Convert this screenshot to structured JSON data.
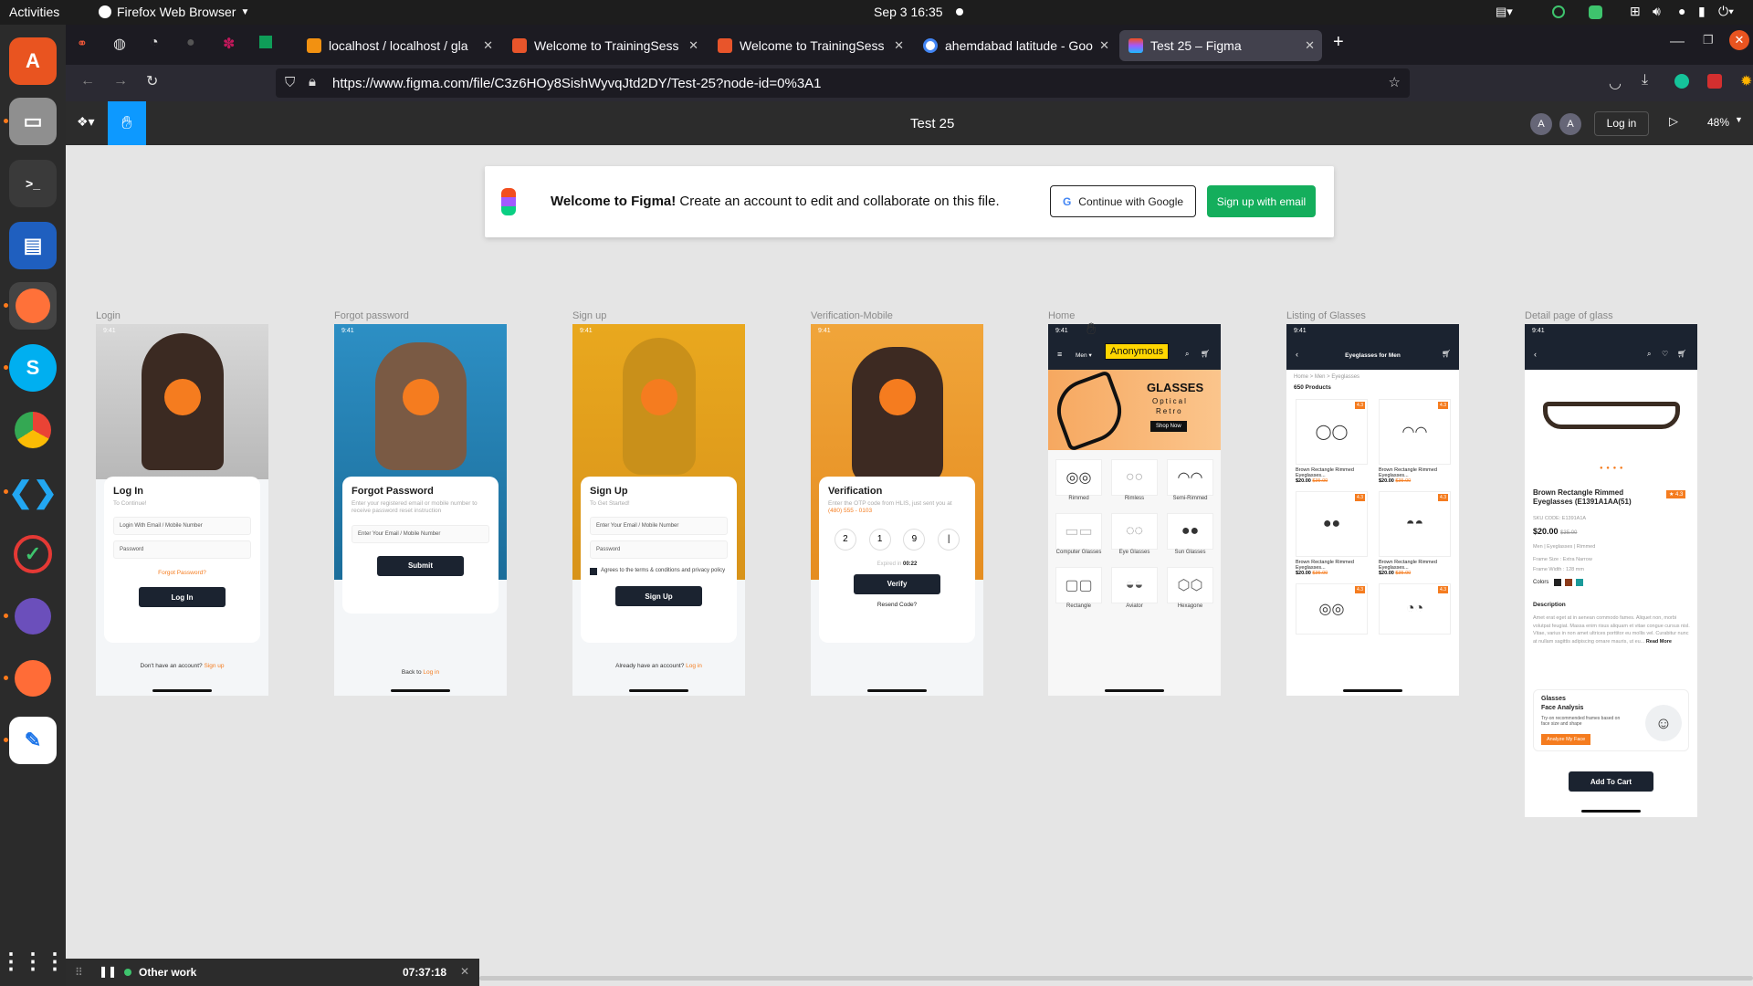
{
  "topbar": {
    "activities": "Activities",
    "app": "Firefox Web Browser",
    "datetime": "Sep 3  16:35"
  },
  "tabs": [
    {
      "label": "localhost / localhost / gla",
      "color": "#f29111"
    },
    {
      "label": "Welcome to TrainingSess",
      "color": "#e8552b"
    },
    {
      "label": "Welcome to TrainingSess",
      "color": "#e8552b"
    },
    {
      "label": "ahemdabad latitude - Goo",
      "color": "#4285f4"
    },
    {
      "label": "Test 25 – Figma",
      "color": "#a259ff"
    }
  ],
  "url": "https://www.figma.com/file/C3z6HOy8SishWyvqJtd2DY/Test-25?node-id=0%3A1",
  "url_host": "figma.com",
  "figma": {
    "file_title": "Test 25",
    "login": "Log in",
    "zoom": "48%",
    "avatar1": "A",
    "avatar2": "A"
  },
  "banner": {
    "bold": "Welcome to Figma!",
    "text": "Create an account to edit and collaborate on this file.",
    "google": "Continue with Google",
    "email": "Sign up with email"
  },
  "frames": {
    "login": {
      "label": "Login",
      "time": "9:41",
      "title": "Log In",
      "sub": "To Continue!",
      "f1": "Login With Email / Mobile Number",
      "f2": "Password",
      "forgot": "Forgot Password?",
      "btn": "Log In",
      "foot": "Don't have an account?",
      "foot_link": "Sign up"
    },
    "forgot": {
      "label": "Forgot password",
      "time": "9:41",
      "title": "Forgot Password",
      "sub": "Enter your registered email or mobile number to receive password reset instruction",
      "f1": "Enter Your Email / Mobile Number",
      "btn": "Submit",
      "foot": "Back to",
      "foot_link": "Log in"
    },
    "signup": {
      "label": "Sign up",
      "time": "9:41",
      "title": "Sign Up",
      "sub": "To Get Started!",
      "f1": "Enter Your Email / Mobile Number",
      "f2": "Password",
      "terms": "Agrees to the terms & conditions and privacy policy",
      "btn": "Sign Up",
      "foot": "Already have an account?",
      "foot_link": "Log in"
    },
    "verify": {
      "label": "Verification-Mobile",
      "time": "9:41",
      "title": "Verification",
      "sub": "Enter the OTP code from HLIS, just sent you at",
      "phone": "(480) 555 - 0103",
      "d1": "2",
      "d2": "1",
      "d3": "9",
      "d4": "|",
      "expired": "Expired in",
      "timer": "00:22",
      "btn": "Verify",
      "resend": "Resend Code?"
    },
    "home": {
      "label": "Home",
      "time": "9:41",
      "menu": "Men",
      "tooltip": "Anonymous",
      "hero1": "GLASSES",
      "hero2": "Optical",
      "hero3": "Retro",
      "shop": "Shop Now",
      "cats": [
        "Rimmed",
        "Rimless",
        "Semi-Rimmed",
        "Computer Glasses",
        "Eye Glasses",
        "Sun Glasses",
        "Rectangle",
        "Aviator",
        "Hexagone"
      ]
    },
    "listing": {
      "label": "Listing of Glasses",
      "time": "9:41",
      "title": "Eyeglasses for Men",
      "crumb": "Home > Men > Eyeglasses",
      "count": "650 Products",
      "item": "Brown Rectangle Rimmed Eyeglasses...",
      "price": "$20.00",
      "old": "$35.00",
      "rating": "4.3"
    },
    "detail": {
      "label": "Detail page of glass",
      "time": "9:41",
      "name": "Brown Rectangle Rimmed Eyeglasses (E1391A1AA(51)",
      "rating": "4.3",
      "sku": "SKU CODE: E1391A1A",
      "price": "$20.00",
      "old": "$35.00",
      "tags": "Men | Eyeglasses | Rimmed",
      "frame_size": "Frame Size : Extra Narrow",
      "frame_width": "Frame Width : 128 mm",
      "colors_label": "Colors",
      "desc_title": "Description",
      "desc": "Amet erat eget at in aenean commodo fames. Aliquet non, morbi volutpat feugiat. Massa enim risus aliquam et vitae congue cursus nisl. Vitae, varius in non amet ultrices porttitor eu mollis vel. Curabitur nunc at nullam sagittis adipiscing ornare mauris, ut eu...",
      "read_more": "Read More",
      "fa1": "Glasses",
      "fa2": "Face Analysis",
      "fa_sub": "Try-on recommended frames based on face size and shape",
      "fa_btn": "Analyze My Face",
      "cart": "Add To Cart"
    }
  },
  "timer": {
    "label": "Other work",
    "time": "07:37:18"
  },
  "colors": {
    "accent": "#f57c1f",
    "figma_green": "#14ae5c",
    "dark": "#1b2330"
  }
}
